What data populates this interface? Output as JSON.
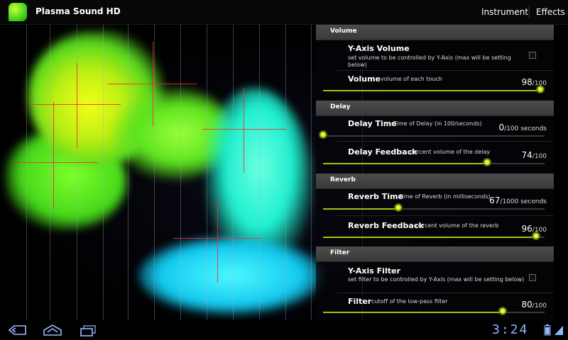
{
  "app": {
    "title": "Plasma Sound HD",
    "actions": {
      "instrument": "Instrument",
      "effects": "Effects"
    }
  },
  "settings": {
    "volume_section": {
      "header": "Volume",
      "y_axis_volume": {
        "title": "Y-Axis Volume",
        "summary": "set volume to be controlled by Y-Axis (max will be setting below)",
        "checked": false
      },
      "volume": {
        "title": "Volume",
        "summary": "volume of each touch",
        "value": "98",
        "unit": "/100",
        "fraction": 0.98
      }
    },
    "delay_section": {
      "header": "Delay",
      "delay_time": {
        "title": "Delay Time",
        "summary": "Time of Delay (in 100/seconds)",
        "value": "0",
        "unit": "/100 seconds",
        "fraction": 0.0
      },
      "delay_feedback": {
        "title": "Delay Feedback",
        "summary": "percent volume of the delay",
        "value": "74",
        "unit": "/100",
        "fraction": 0.74
      }
    },
    "reverb_section": {
      "header": "Reverb",
      "reverb_time": {
        "title": "Reverb Time",
        "summary": "Time of Reverb (in milliseconds)",
        "value": "67",
        "unit": "/1000 seconds",
        "fraction": 0.34
      },
      "reverb_feedback": {
        "title": "Reverb Feedback",
        "summary": "percent volume of the reverb",
        "value": "96",
        "unit": "/100",
        "fraction": 0.96
      }
    },
    "filter_section": {
      "header": "Filter",
      "y_axis_filter": {
        "title": "Y-Axis Filter",
        "summary": "set filter to be controlled by Y-Axis (max will be setting below)",
        "checked": false
      },
      "filter": {
        "title": "Filter",
        "summary": "cutoff of the low-pass filter",
        "value": "80",
        "unit": "/100",
        "fraction": 0.81
      }
    }
  },
  "status_bar": {
    "time": "3:24"
  },
  "colors": {
    "accent": "#a2c40c",
    "section_header": "#444444",
    "clock": "#8fb7ff",
    "plasma_green": "#5de81c",
    "plasma_yellow": "#e8f514",
    "plasma_cyan": "#1bf0e0"
  },
  "icons": {
    "app": "plasma-sound-app-icon",
    "nav": [
      "back-icon",
      "home-icon",
      "recent-apps-icon"
    ],
    "status": [
      "battery-icon",
      "signal-icon"
    ]
  }
}
